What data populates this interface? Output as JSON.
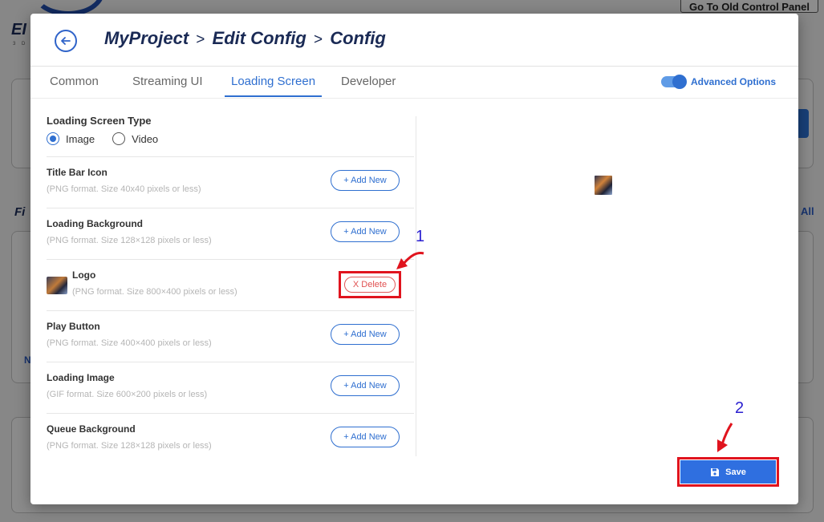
{
  "background": {
    "brand": "EI",
    "brand_sub": "3 D",
    "old_panel_button": "Go To Old Control Panel",
    "section_heading": "Fi",
    "view_all": "All",
    "side_letter": "N"
  },
  "modal": {
    "breadcrumbs": [
      "MyProject",
      "Edit Config",
      "Config"
    ],
    "breadcrumb_separator": ">",
    "tabs": [
      {
        "label": "Common",
        "active": false
      },
      {
        "label": "Streaming UI",
        "active": false
      },
      {
        "label": "Loading Screen",
        "active": true
      },
      {
        "label": "Developer",
        "active": false
      }
    ],
    "advanced_options": {
      "label": "Advanced Options",
      "enabled": true
    },
    "loading_screen_type": {
      "title": "Loading Screen Type",
      "options": [
        {
          "label": "Image",
          "selected": true
        },
        {
          "label": "Video",
          "selected": false
        }
      ]
    },
    "items": [
      {
        "name": "Title Bar Icon",
        "desc": "(PNG format. Size 40x40 pixels or less)",
        "action": "+ Add New"
      },
      {
        "name": "Loading Background",
        "desc": "(PNG format. Size 128×128 pixels or less)",
        "action": "+ Add New"
      },
      {
        "name": "Logo",
        "desc": "(PNG format. Size 800×400 pixels or less)",
        "action": "X Delete"
      },
      {
        "name": "Play Button",
        "desc": "(PNG format. Size 400×400 pixels or less)",
        "action": "+ Add New"
      },
      {
        "name": "Loading Image",
        "desc": "(GIF format. Size 600×200 pixels or less)",
        "action": "+ Add New"
      },
      {
        "name": "Queue Background",
        "desc": "(PNG format. Size 128×128 pixels or less)",
        "action": "+ Add New"
      }
    ],
    "save_label": "Save"
  },
  "annotations": {
    "step1": "1",
    "step2": "2"
  },
  "colors": {
    "accent": "#2f6fd0",
    "highlight": "#e0141e",
    "annotation": "#2a1fd0"
  }
}
